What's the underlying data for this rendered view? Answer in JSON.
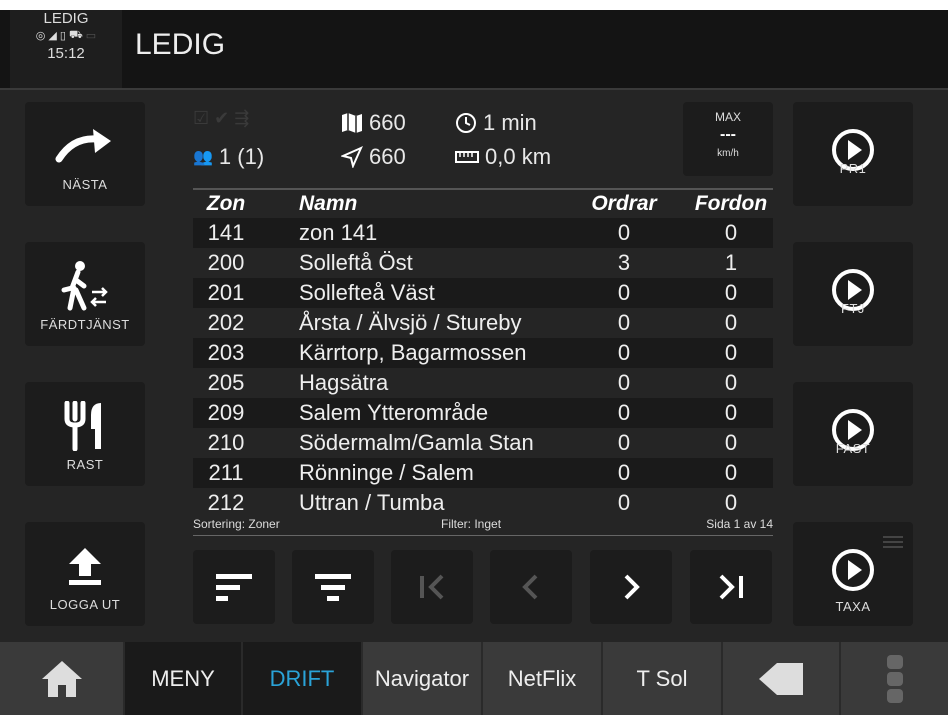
{
  "status": {
    "state": "LEDIG",
    "time": "15:12"
  },
  "title": "LEDIG",
  "left_buttons": [
    {
      "label": "NÄSTA",
      "icon": "redo-arrow-icon"
    },
    {
      "label": "FÄRDTJÄNST",
      "icon": "person-walking-icon"
    },
    {
      "label": "RAST",
      "icon": "fork-knife-icon"
    },
    {
      "label": "LOGGA UT",
      "icon": "upload-icon"
    }
  ],
  "right_buttons": [
    {
      "label": "PR1",
      "icon": "play-circle-icon"
    },
    {
      "label": "FTJ",
      "icon": "play-circle-icon"
    },
    {
      "label": "FAST",
      "icon": "play-circle-icon"
    },
    {
      "label": "TAXA",
      "icon": "play-circle-icon"
    }
  ],
  "info": {
    "people": "1 (1)",
    "map_count": "660",
    "nav_count": "660",
    "time": "1 min",
    "distance": "0,0 km"
  },
  "max": {
    "label": "MAX",
    "value": "---",
    "unit": "km/h"
  },
  "table": {
    "headers": {
      "zone": "Zon",
      "name": "Namn",
      "orders": "Ordrar",
      "vehicles": "Fordon"
    },
    "rows": [
      {
        "zone": "141",
        "name": "zon 141",
        "orders": "0",
        "vehicles": "0"
      },
      {
        "zone": "200",
        "name": "Solleftå Öst",
        "orders": "3",
        "vehicles": "1"
      },
      {
        "zone": "201",
        "name": "Sollefteå Väst",
        "orders": "0",
        "vehicles": "0"
      },
      {
        "zone": "202",
        "name": "Årsta / Älvsjö / Stureby",
        "orders": "0",
        "vehicles": "0"
      },
      {
        "zone": "203",
        "name": "Kärrtorp, Bagarmossen",
        "orders": "0",
        "vehicles": "0"
      },
      {
        "zone": "205",
        "name": "Hagsätra",
        "orders": "0",
        "vehicles": "0"
      },
      {
        "zone": "209",
        "name": "Salem Ytterområde",
        "orders": "0",
        "vehicles": "0"
      },
      {
        "zone": "210",
        "name": "Södermalm/Gamla Stan",
        "orders": "0",
        "vehicles": "0"
      },
      {
        "zone": "211",
        "name": "Rönninge / Salem",
        "orders": "0",
        "vehicles": "0"
      },
      {
        "zone": "212",
        "name": "Uttran / Tumba",
        "orders": "0",
        "vehicles": "0"
      }
    ]
  },
  "footer": {
    "sort": "Sortering: Zoner",
    "filter": "Filter: Inget",
    "page": "Sida 1 av 14"
  },
  "nav": {
    "menu": "MENY",
    "drift": "DRIFT",
    "navigator": "Navigator",
    "netflix": "NetFlix",
    "tsol": "T Sol"
  },
  "colors": {
    "accent": "#2aa3d8",
    "background": "#252525",
    "button": "#1c1c1c"
  }
}
